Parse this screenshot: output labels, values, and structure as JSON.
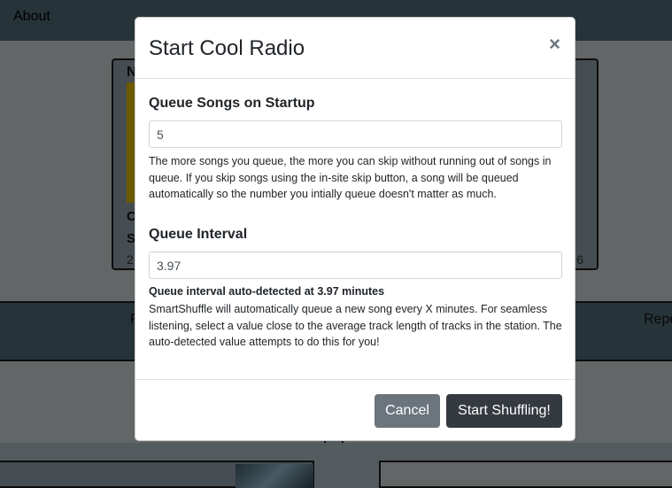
{
  "background": {
    "nav_about": "About",
    "card": {
      "n": "N",
      "c1": "C",
      "c2": "S",
      "c3": "2",
      "c4": "6"
    },
    "band": {
      "f": "F",
      "rep": "Repe"
    }
  },
  "modal": {
    "title": "Start Cool Radio",
    "close_glyph": "×",
    "queue_songs": {
      "label": "Queue Songs on Startup",
      "value": "5",
      "help": "The more songs you queue, the more you can skip without running out of songs in queue. If you skip songs using the in-site skip button, a song will be queued automatically so the number you intially queue doesn't matter as much."
    },
    "queue_interval": {
      "label": "Queue Interval",
      "value": "3.97",
      "detected": "Queue interval auto-detected at 3.97 minutes",
      "help": "SmartShuffle will automatically queue a new song every X minutes. For seamless listening, select a value close to the average track length of tracks in the station. The auto-detected value attempts to do this for you!"
    },
    "cancel_label": "Cancel",
    "start_label": "Start Shuffling!"
  },
  "colors": {
    "nav_bg": "#4d6873",
    "cancel_bg": "#6c757d",
    "start_bg": "#343a40",
    "accent_yellow": "#d8b300"
  }
}
